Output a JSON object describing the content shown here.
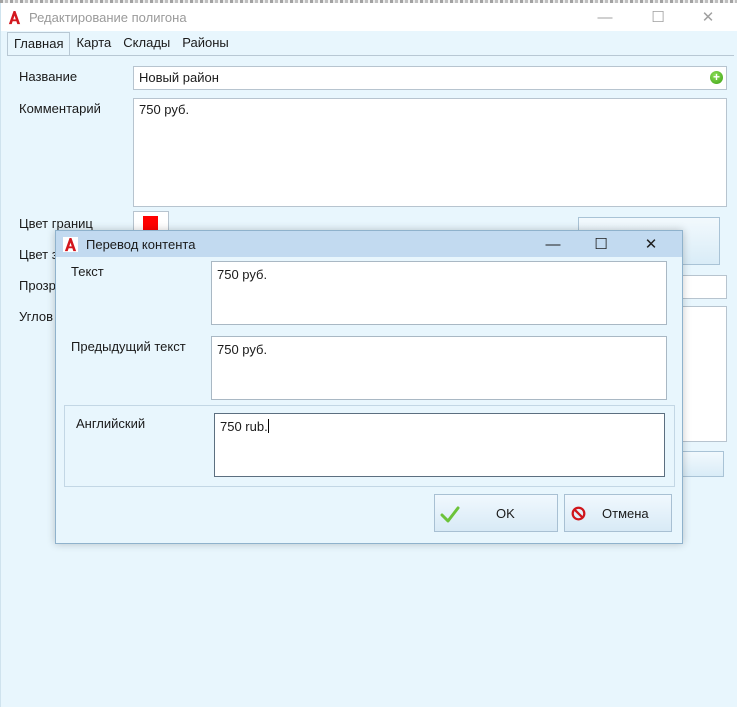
{
  "main_window": {
    "title": "Редактирование полигона",
    "tabs": [
      "Главная",
      "Карта",
      "Склады",
      "Районы"
    ],
    "controls": {
      "minimize": "—",
      "maximize": "☐",
      "close": "✕"
    },
    "fields": {
      "name_label": "Название",
      "name_value": "Новый район",
      "comment_label": "Комментарий",
      "comment_value": "750 руб.",
      "border_color_label": "Цвет границ",
      "fill_color_label_partial": "Цвет з",
      "transparency_label_partial": "Прозр",
      "corners_label_partial": "Углов"
    },
    "border_color": "#ff0000"
  },
  "dialog": {
    "title": "Перевод контента",
    "controls": {
      "minimize": "—",
      "maximize": "☐",
      "close": "✕"
    },
    "text_label": "Текст",
    "text_value": "750 руб.",
    "prev_label": "Предыдущий текст",
    "prev_value": "750 руб.",
    "english_label": "Английский",
    "english_value": "750 rub.",
    "ok_label": "OK",
    "cancel_label": "Отмена"
  },
  "icons": {
    "app": "app-logo-icon",
    "add": "plus-circle-icon",
    "ok": "checkmark-icon",
    "cancel": "no-entry-icon"
  }
}
